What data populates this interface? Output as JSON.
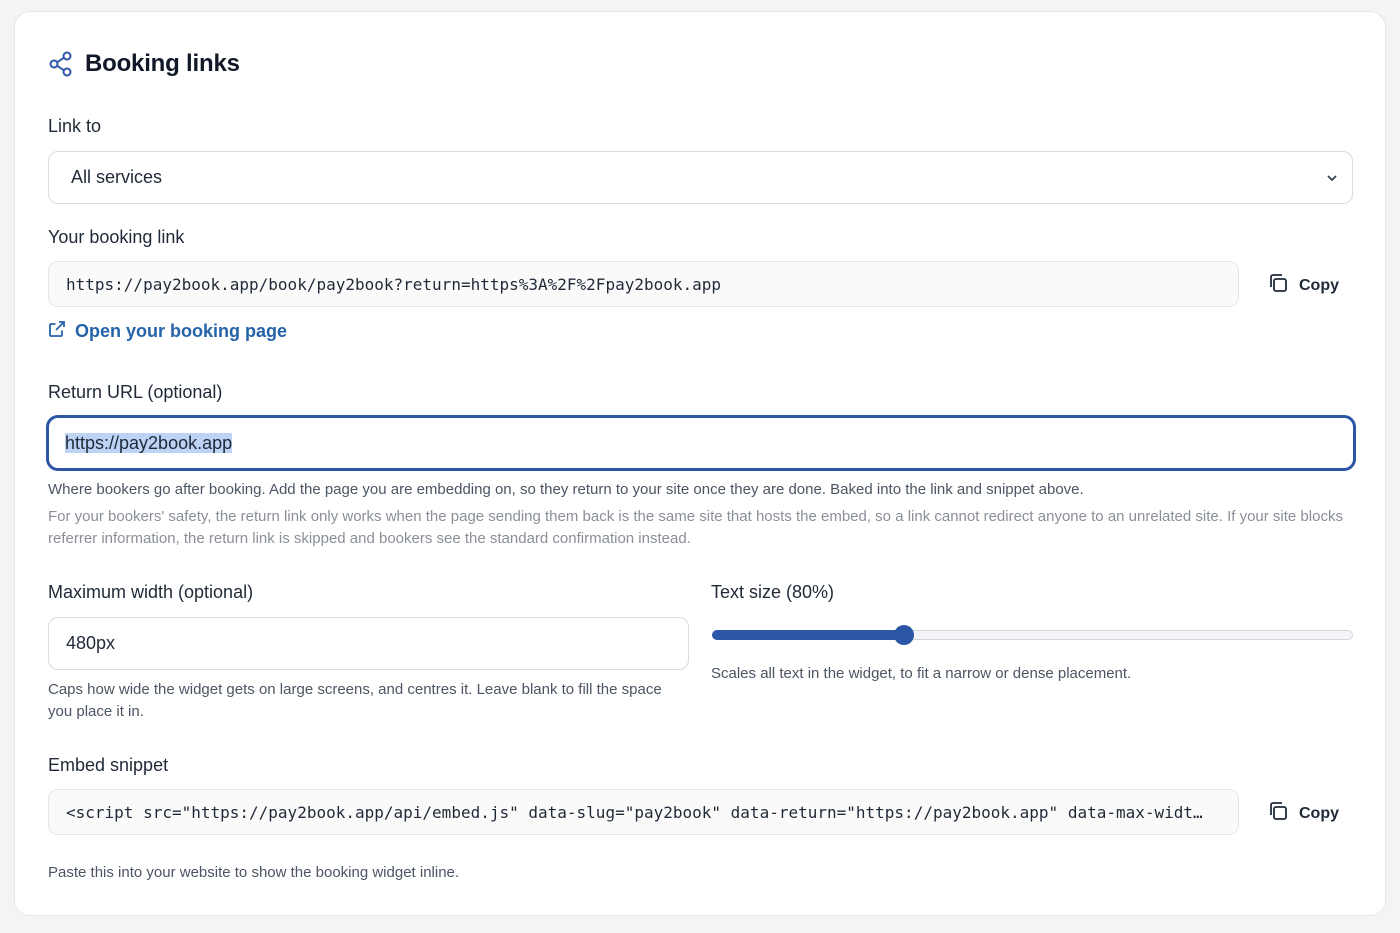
{
  "header": {
    "title": "Booking links",
    "icon": "share-icon"
  },
  "link_to": {
    "label": "Link to",
    "selected": "All services"
  },
  "booking_link": {
    "label": "Your booking link",
    "value": "https://pay2book.app/book/pay2book?return=https%3A%2F%2Fpay2book.app",
    "copy_label": "Copy",
    "open_label": "Open your booking page"
  },
  "return_url": {
    "label": "Return URL (optional)",
    "value": "https://pay2book.app",
    "help": "Where bookers go after booking. Add the page you are embedding on, so they return to your site once they are done. Baked into the link and snippet above.",
    "note": "For your bookers' safety, the return link only works when the page sending them back is the same site that hosts the embed, so a link cannot redirect anyone to an unrelated site. If your site blocks referrer information, the return link is skipped and bookers see the standard confirmation instead."
  },
  "max_width": {
    "label": "Maximum width (optional)",
    "value": "480px",
    "help": "Caps how wide the widget gets on large screens, and centres it. Leave blank to fill the space you place it in."
  },
  "text_size": {
    "label": "Text size (80%)",
    "level_fraction": 0.3,
    "help": "Scales all text in the widget, to fit a narrow or dense placement."
  },
  "embed": {
    "label": "Embed snippet",
    "value": "<script src=\"https://pay2book.app/api/embed.js\" data-slug=\"pay2book\" data-return=\"https://pay2book.app\" data-max-widt…",
    "copy_label": "Copy",
    "help": "Paste this into your website to show the booking widget inline."
  },
  "colors": {
    "accent": "#2e56a6",
    "link": "#2563a8",
    "selection": "#bcd3f5"
  }
}
